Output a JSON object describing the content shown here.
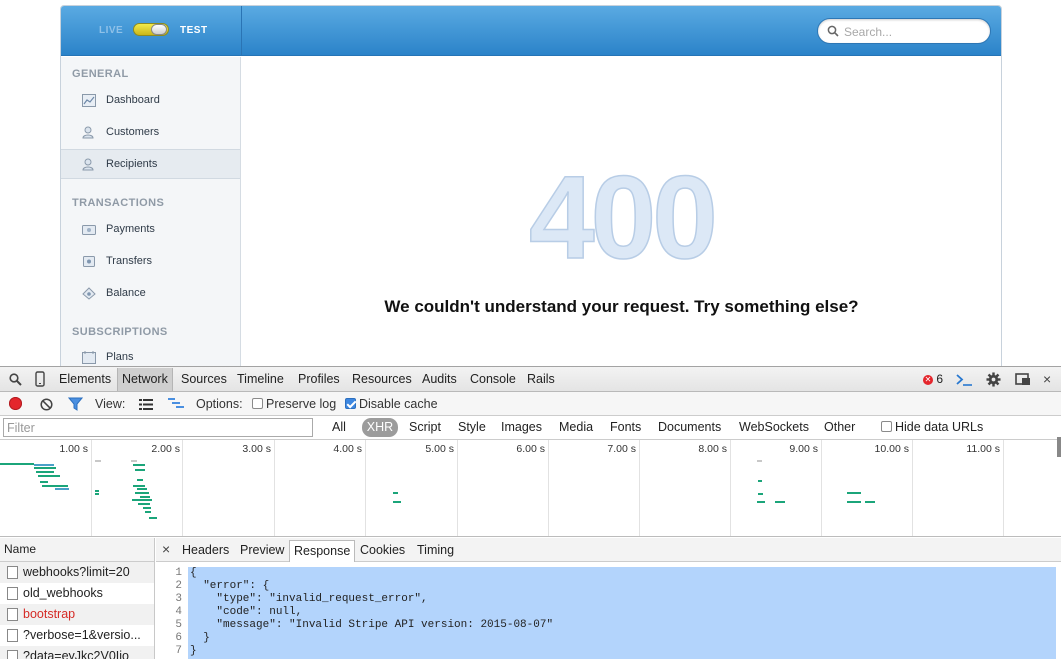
{
  "app": {
    "mode_live": "LIVE",
    "mode_test": "TEST",
    "search_placeholder": "Search...",
    "sidebar": {
      "sections": [
        {
          "title": "GENERAL",
          "items": [
            "Dashboard",
            "Customers",
            "Recipients"
          ]
        },
        {
          "title": "TRANSACTIONS",
          "items": [
            "Payments",
            "Transfers",
            "Balance"
          ]
        },
        {
          "title": "SUBSCRIPTIONS",
          "items": [
            "Plans"
          ]
        }
      ],
      "active_item": "Recipients"
    },
    "error_code": "400",
    "error_message": "We couldn't understand your request. Try something else?"
  },
  "devtools": {
    "tabs": [
      "Elements",
      "Network",
      "Sources",
      "Timeline",
      "Profiles",
      "Resources",
      "Audits",
      "Console",
      "Rails"
    ],
    "selected_tab": "Network",
    "error_count": "6",
    "controls": {
      "view_label": "View:",
      "options_label": "Options:",
      "preserve_log": "Preserve log",
      "preserve_log_checked": false,
      "disable_cache": "Disable cache",
      "disable_cache_checked": true
    },
    "filter_placeholder": "Filter",
    "filter_types": [
      "All",
      "XHR",
      "Script",
      "Style",
      "Images",
      "Media",
      "Fonts",
      "Documents",
      "WebSockets",
      "Other"
    ],
    "selected_filter": "XHR",
    "hide_data_urls": "Hide data URLs",
    "timeline_ticks": [
      "1.00 s",
      "2.00 s",
      "3.00 s",
      "4.00 s",
      "5.00 s",
      "6.00 s",
      "7.00 s",
      "8.00 s",
      "9.00 s",
      "10.00 s",
      "11.00 s"
    ],
    "name_header": "Name",
    "requests": [
      {
        "name": "webhooks?limit=20",
        "error": false
      },
      {
        "name": "old_webhooks",
        "error": false
      },
      {
        "name": "bootstrap",
        "error": true
      },
      {
        "name": "?verbose=1&versio...",
        "error": false
      },
      {
        "name": "?data=eyJkc2V0Ijo",
        "error": false
      }
    ],
    "detail_tabs": [
      "Headers",
      "Preview",
      "Response",
      "Cookies",
      "Timing"
    ],
    "selected_detail_tab": "Response",
    "close_symbol": "×",
    "response_line_numbers": [
      "1",
      "2",
      "3",
      "4",
      "5",
      "6",
      "7"
    ],
    "response_lines": [
      "{",
      "  \"error\": {",
      "    \"type\": \"invalid_request_error\",",
      "    \"code\": null,",
      "    \"message\": \"Invalid Stripe API version: 2015-08-07\"",
      "  }",
      "}"
    ],
    "colors": {
      "error_red": "#e4262c",
      "selection_blue": "#b3d4fc",
      "waterfall_green": "#1ba57a"
    }
  }
}
